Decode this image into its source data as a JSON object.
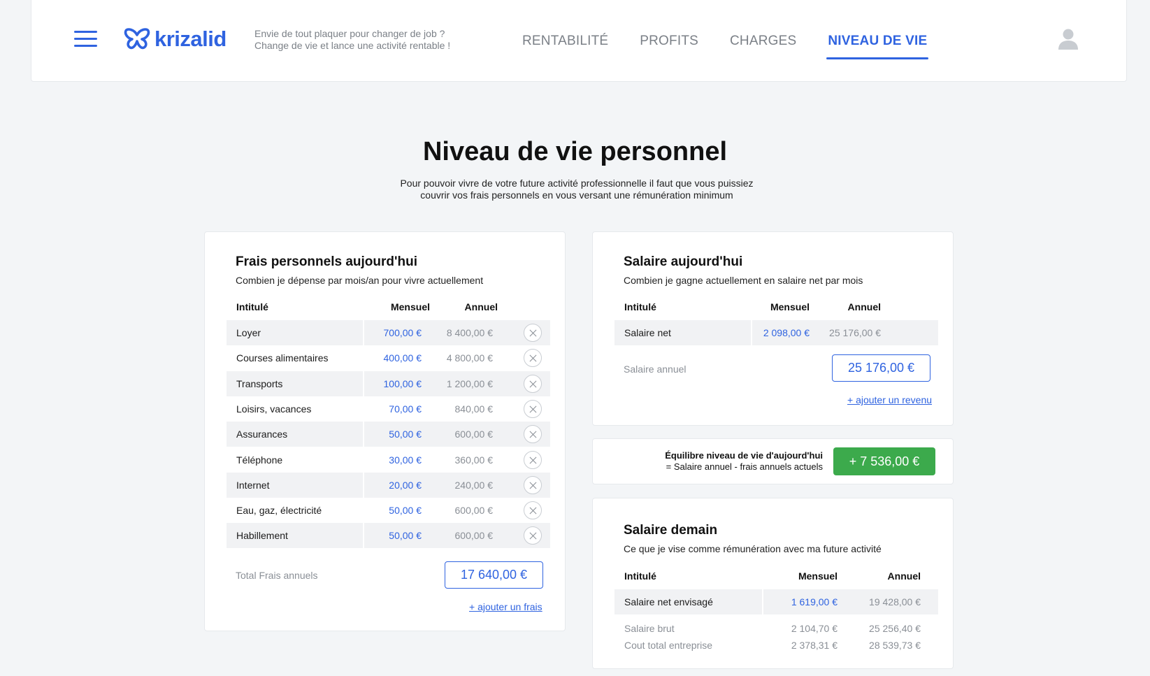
{
  "header": {
    "brand": "krizalid",
    "tagline_line1": "Envie de tout plaquer pour changer de job ?",
    "tagline_line2": "Change de vie et lance une activité rentable !",
    "nav": [
      "RENTABILITÉ",
      "PROFITS",
      "CHARGES",
      "NIVEAU DE VIE"
    ],
    "active_nav": "NIVEAU DE VIE",
    "brand_color": "#2f63e0"
  },
  "page": {
    "title": "Niveau de vie personnel",
    "subtitle_line1": "Pour pouvoir vivre de votre future activité professionnelle il faut que vous puissiez",
    "subtitle_line2": "couvrir vos frais personnels en vous versant une rémunération minimum"
  },
  "frais": {
    "title": "Frais personnels aujourd'hui",
    "desc": "Combien je dépense par mois/an pour vivre actuellement",
    "col_label": "Intitulé",
    "col_monthly": "Mensuel",
    "col_annual": "Annuel",
    "rows": [
      {
        "label": "Loyer",
        "monthly": "700,00 €",
        "annual": "8 400,00 €"
      },
      {
        "label": "Courses alimentaires",
        "monthly": "400,00 €",
        "annual": "4 800,00 €"
      },
      {
        "label": "Transports",
        "monthly": "100,00 €",
        "annual": "1 200,00 €"
      },
      {
        "label": "Loisirs, vacances",
        "monthly": "70,00 €",
        "annual": "840,00 €"
      },
      {
        "label": "Assurances",
        "monthly": "50,00 €",
        "annual": "600,00 €"
      },
      {
        "label": "Téléphone",
        "monthly": "30,00 €",
        "annual": "360,00 €"
      },
      {
        "label": "Internet",
        "monthly": "20,00 €",
        "annual": "240,00 €"
      },
      {
        "label": "Eau, gaz, électricité",
        "monthly": "50,00 €",
        "annual": "600,00 €"
      },
      {
        "label": "Habillement",
        "monthly": "50,00 €",
        "annual": "600,00 €"
      }
    ],
    "total_label": "Total Frais annuels",
    "total_value": "17 640,00 €",
    "add_link": "+ ajouter un frais"
  },
  "salaire": {
    "title": "Salaire aujourd'hui",
    "desc": "Combien je gagne actuellement en salaire net par mois",
    "col_label": "Intitulé",
    "col_monthly": "Mensuel",
    "col_annual": "Annuel",
    "rows": [
      {
        "label": "Salaire net",
        "monthly": "2 098,00 €",
        "annual": "25 176,00 €"
      }
    ],
    "total_label": "Salaire annuel",
    "total_value": "25 176,00 €",
    "add_link": "+ ajouter un revenu"
  },
  "equilibre": {
    "line1": "Équilibre niveau de vie d'aujourd'hui",
    "line2": "= Salaire annuel - frais annuels actuels",
    "value": "+ 7 536,00 €",
    "color": "#3caa4c"
  },
  "demain": {
    "title": "Salaire demain",
    "desc": "Ce que je vise comme rémunération avec ma future activité",
    "col_label": "Intitulé",
    "col_monthly": "Mensuel",
    "col_annual": "Annuel",
    "row": {
      "label": "Salaire net envisagé",
      "monthly": "1 619,00 €",
      "annual": "19 428,00 €"
    },
    "extra": [
      {
        "label": "Salaire brut",
        "monthly": "2 104,70 €",
        "annual": "25 256,40 €"
      },
      {
        "label": "Cout total entreprise",
        "monthly": "2 378,31 €",
        "annual": "28 539,73 €"
      }
    ]
  }
}
